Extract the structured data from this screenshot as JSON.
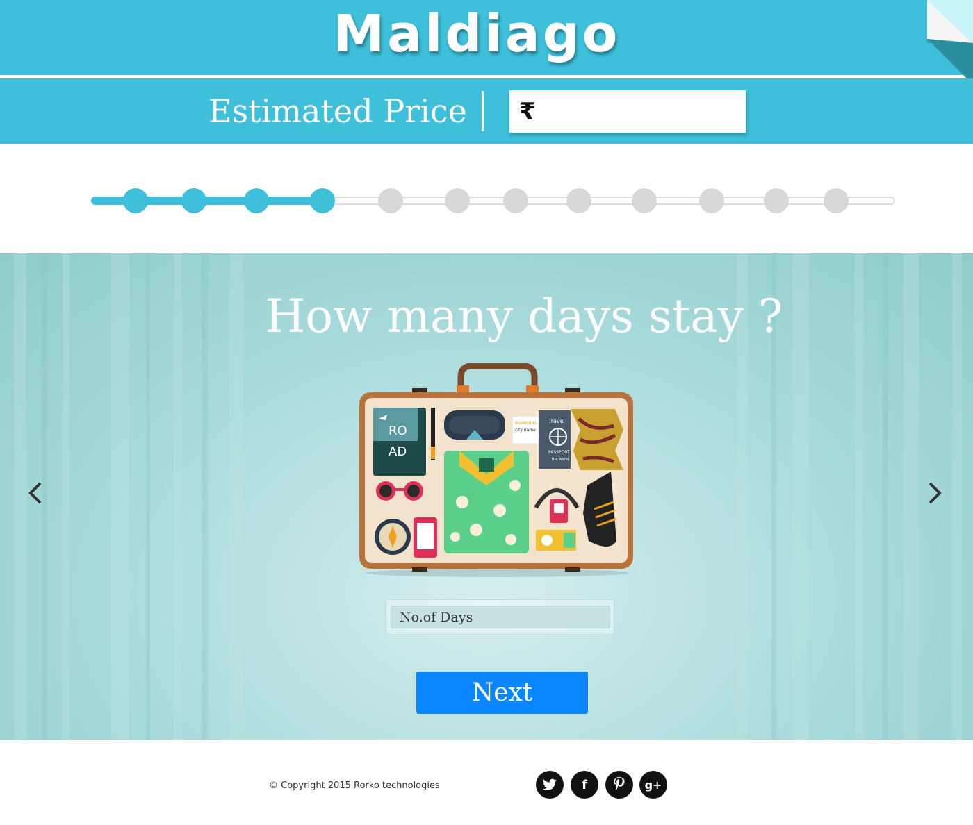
{
  "header": {
    "brand": "Maldiago"
  },
  "price_bar": {
    "label": "Estimated Price",
    "currency_symbol": "₹",
    "value": ""
  },
  "progress": {
    "total_steps": 12,
    "current_step": 4
  },
  "step": {
    "question": "How many days stay ?",
    "days_placeholder": "No.of Days",
    "next_label": "Next",
    "prev_arrow_icon": "chevron-left-icon",
    "next_arrow_icon": "chevron-right-icon"
  },
  "suitcase_labels": {
    "road_top": "RO",
    "road_bottom": "AD",
    "boarding": "BOARDING",
    "city": "city name",
    "passport_top": "Travel",
    "passport_bottom": "PASSPORT",
    "passport_sub": "The World"
  },
  "footer": {
    "copyright": "© Copyright 2015 Rorko technologies",
    "social": [
      {
        "name": "twitter-icon",
        "glyph": "t"
      },
      {
        "name": "facebook-icon",
        "glyph": "f"
      },
      {
        "name": "pinterest-icon",
        "glyph": "p"
      },
      {
        "name": "google-plus-icon",
        "glyph": "g+"
      }
    ]
  },
  "colors": {
    "accent": "#3ebfda",
    "button": "#0a86ff",
    "inactive_dot": "#d8d8d8"
  }
}
